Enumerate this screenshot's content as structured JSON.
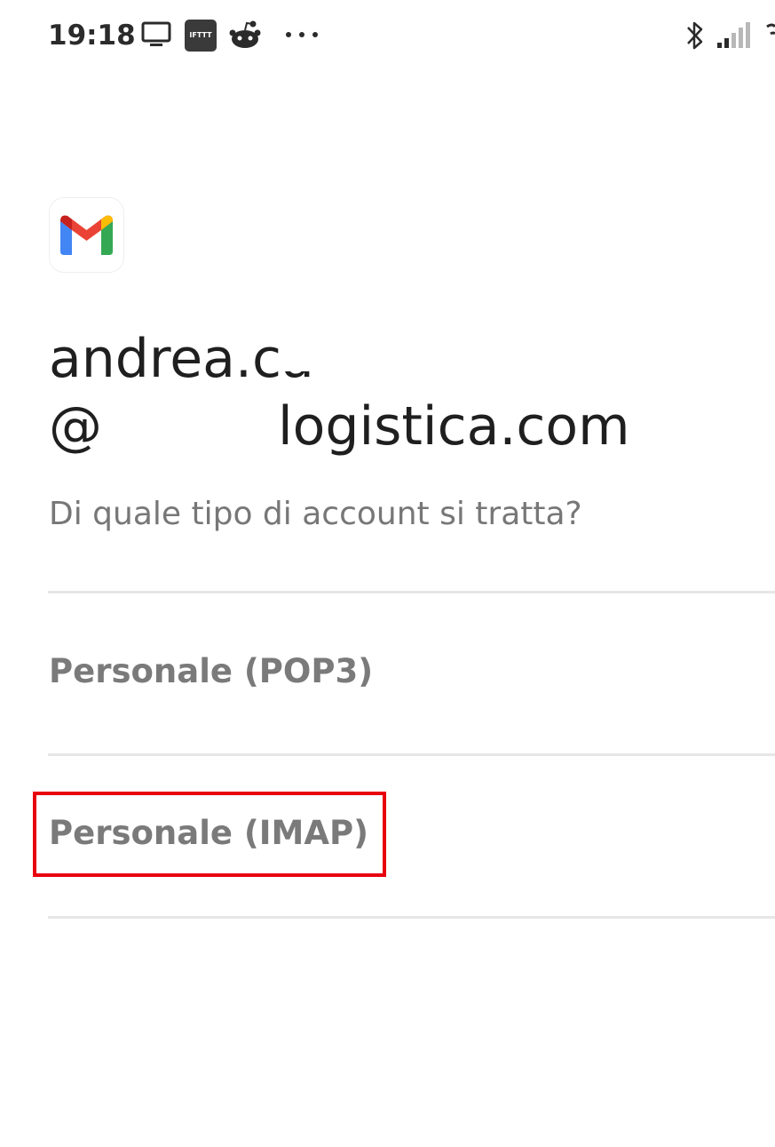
{
  "status_bar": {
    "time": "19:18",
    "icons": [
      "screen-cast-icon",
      "ifttt-icon",
      "reddit-icon",
      "more-notifications-icon",
      "bluetooth-icon",
      "signal-icon",
      "wifi-icon"
    ],
    "ifttt_label": "IFTTT",
    "more_label": "•••"
  },
  "app": {
    "logo": "gmail-logo",
    "colors": {
      "red": "#EA4335",
      "blue": "#4285F4",
      "green": "#34A853",
      "yellow": "#FBBC04",
      "dark_red": "#C5221F"
    }
  },
  "account": {
    "line1": "andrea.ca",
    "line2_prefix": "@",
    "line2_suffix": "logistica.com"
  },
  "prompt": "Di quale tipo di account si tratta?",
  "options": [
    {
      "label": "Personale (POP3)"
    },
    {
      "label": "Personale (IMAP)",
      "highlighted": true
    }
  ],
  "highlight_color": "#e8000c"
}
